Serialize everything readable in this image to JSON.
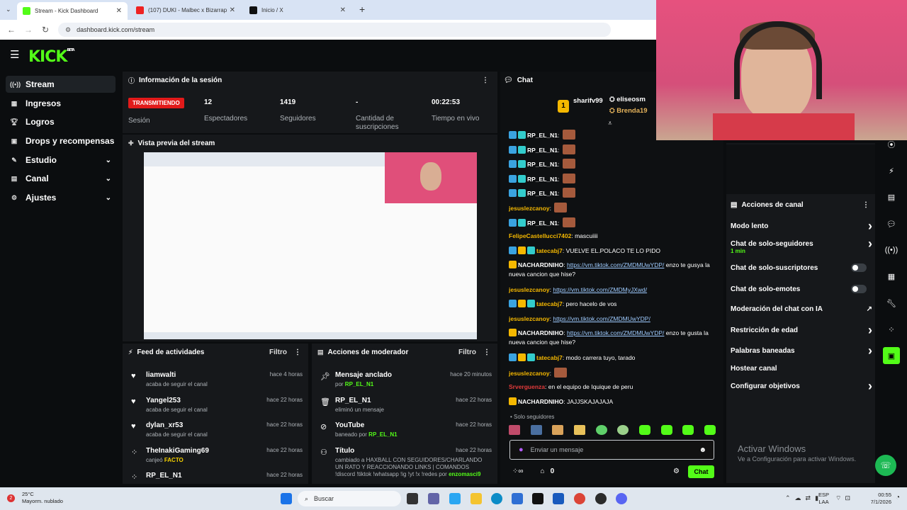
{
  "browser": {
    "tabs": [
      {
        "title": "Stream - Kick Dashboard",
        "active": true
      },
      {
        "title": "(107) DUKI - Malbec x Bizarrap"
      },
      {
        "title": "Inicio / X"
      }
    ],
    "new_tab": "+",
    "url": "dashboard.kick.com/stream"
  },
  "brand": {
    "logo": "KICK",
    "beta": "BETA",
    "accent": "#53fc18"
  },
  "sidebar": {
    "items": [
      {
        "label": "Stream",
        "icon": "broadcast-icon"
      },
      {
        "label": "Ingresos",
        "icon": "money-icon"
      },
      {
        "label": "Logros",
        "icon": "trophy-icon"
      },
      {
        "label": "Drops y recompensas",
        "icon": "gift-icon"
      },
      {
        "label": "Estudio",
        "icon": "studio-icon"
      },
      {
        "label": "Canal",
        "icon": "channel-icon"
      },
      {
        "label": "Ajustes",
        "icon": "gear-icon"
      }
    ]
  },
  "session": {
    "title": "Información de la sesión",
    "live_badge": "TRANSMITIENDO",
    "session_label": "Sesión",
    "stats": [
      {
        "value": "12",
        "label": "Espectadores"
      },
      {
        "value": "1419",
        "label": "Seguidores"
      },
      {
        "value": "-",
        "label": "Cantidad de suscripciones"
      },
      {
        "value": "00:22:53",
        "label": "Tiempo en vivo"
      }
    ]
  },
  "preview": {
    "title": "Vista previa del stream"
  },
  "activity": {
    "title": "Feed de actividades",
    "filter": "Filtro",
    "items": [
      {
        "name": "liamwalti",
        "time": "hace 4 horas",
        "sub": "acaba de seguir el canal"
      },
      {
        "name": "Yangel253",
        "time": "hace 22 horas",
        "sub": "acaba de seguir el canal"
      },
      {
        "name": "dylan_xr53",
        "time": "hace 22 horas",
        "sub": "acaba de seguir el canal"
      },
      {
        "name": "TheInakiGaming69",
        "time": "hace 22 horas",
        "sub": "canjeó",
        "sub_hl": "FACTO"
      },
      {
        "name": "RP_EL_N1",
        "time": "hace 22 horas",
        "sub": ""
      }
    ]
  },
  "modactions": {
    "title": "Acciones de moderador",
    "filter": "Filtro",
    "items": [
      {
        "name": "Mensaje anclado",
        "time": "hace 20 minutos",
        "sub": "por",
        "sub_hl": "RP_EL_N1"
      },
      {
        "name": "RP_EL_N1",
        "time": "hace 22 horas",
        "sub": "eliminó un mensaje"
      },
      {
        "name": "YouTube",
        "time": "hace 22 horas",
        "sub": "baneado por",
        "sub_hl": "RP_EL_N1"
      },
      {
        "name": "Título",
        "time": "hace 22 horas",
        "sub": "cambiado a HAXBALL CON SEGUIDORES/CHARLANDO UN RATO Y REACCIONANDO LINKS | COMANDOS !discord !tiktok !whatsapp !ig !yt !x !redes por",
        "sub_hl": "enzomasci9"
      }
    ]
  },
  "chat": {
    "title": "Chat",
    "top_user": "sharifv99",
    "top_rank": "1",
    "top_side": [
      "eliseosm",
      "Brenda19"
    ],
    "lines": [
      {
        "user": "RP_EL_N1",
        "color": "#fff",
        "text": ""
      },
      {
        "user": "RP_EL_N1",
        "color": "#fff",
        "text": ""
      },
      {
        "user": "RP_EL_N1",
        "color": "#fff",
        "text": ""
      },
      {
        "user": "RP_EL_N1",
        "color": "#fff",
        "text": ""
      },
      {
        "user": "RP_EL_N1",
        "color": "#fff",
        "text": ""
      },
      {
        "user": "jesuslezcanoy",
        "color": "#f5b800",
        "text": ""
      },
      {
        "user": "RP_EL_N1",
        "color": "#fff",
        "text": ""
      },
      {
        "user": "FelipeCastellucci7402",
        "color": "#f5b800",
        "text": "mascuiiii"
      },
      {
        "user": "tatecabj7",
        "color": "#f5b800",
        "text": "VUELVE EL.POLACO TE LO PIDO"
      },
      {
        "user": "NACHARDNIHO",
        "color": "#fff",
        "link": "https://vm.tiktok.com/ZMDMUwYDP/",
        "text": "enzo te gusya la nueva cancion que hise?"
      },
      {
        "user": "jesuslezcanoy",
        "color": "#f5b800",
        "link": "https://vm.tiktok.com/ZMDMyJXwd/",
        "text": ""
      },
      {
        "user": "tatecabj7",
        "color": "#f5b800",
        "text": "pero hacelo de vos"
      },
      {
        "user": "jesuslezcanoy",
        "color": "#f5b800",
        "link": "https://vm.tiktok.com/ZMDMUwYDP/",
        "text": ""
      },
      {
        "user": "NACHARDNIHO",
        "color": "#fff",
        "link": "https://vm.tiktok.com/ZMDMUwYDP/",
        "text": "enzo te gusta la nueva cancion que hise?"
      },
      {
        "user": "tatecabj7",
        "color": "#f5b800",
        "text": "modo carrera tuyo, tarado"
      },
      {
        "user": "jesuslezcanoy",
        "color": "#f5b800",
        "text": ""
      },
      {
        "user": "Srverguenza",
        "color": "#e23b3b",
        "text": "en el equipo de Iquique de peru"
      },
      {
        "user": "NACHARDNIHO",
        "color": "#fff",
        "text": "JAJJSKAJAJAJA"
      }
    ],
    "mode_label": "Solo seguidores",
    "input_placeholder": "Enviar un mensaje",
    "points": "0",
    "send_label": "Chat"
  },
  "channel_actions": {
    "title": "Acciones de canal",
    "rows": [
      {
        "label": "Modo lento",
        "control": "arrow"
      },
      {
        "label": "Chat de solo-seguidores",
        "sub": "1 min",
        "control": "arrow"
      },
      {
        "label": "Chat de solo-suscriptores",
        "control": "toggle"
      },
      {
        "label": "Chat de solo-emotes",
        "control": "toggle"
      },
      {
        "label": "Moderación del chat con IA",
        "control": "external"
      },
      {
        "label": "Restricción de edad",
        "control": "arrow"
      },
      {
        "label": "Palabras baneadas",
        "control": "arrow"
      },
      {
        "label": "Hostear canal",
        "control": "none"
      },
      {
        "label": "Configurar objetivos",
        "control": "arrow"
      }
    ]
  },
  "windows": {
    "activate_title": "Activar Windows",
    "activate_sub": "Ve a Configuración para activar Windows.",
    "weather_temp": "25°C",
    "weather_desc": "Mayorm. nublado",
    "weather_badge": "2",
    "search": "Buscar",
    "lang": "ESP",
    "lang2": "LAA",
    "time": "00:55",
    "date": "7/1/2026"
  }
}
